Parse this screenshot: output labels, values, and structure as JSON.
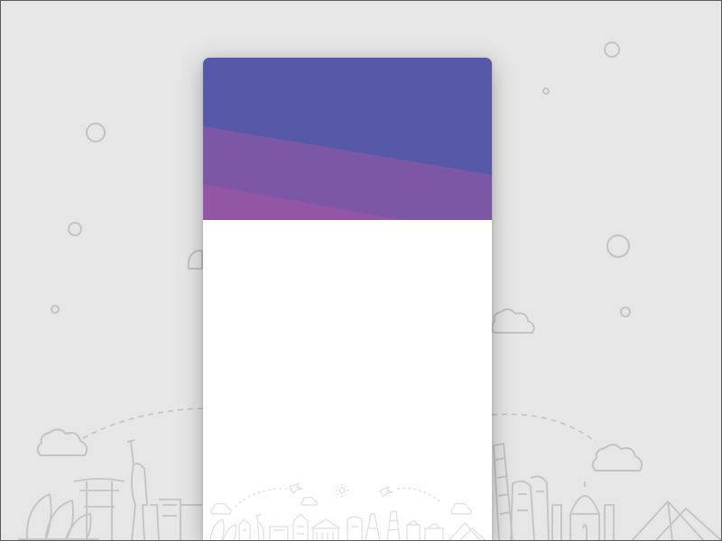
{
  "colors": {
    "background": "#e6e6e6",
    "line_art": "#c3c3c3",
    "card": "#ffffff",
    "header_top": "#5658a8",
    "header_mid": "#7c57a6",
    "header_bottom": "#9356a5"
  },
  "icons": {
    "backdrop": [
      "bubble-icon",
      "cloud-icon",
      "flight-path-icon",
      "sydney-opera-house-icon",
      "torii-gate-icon",
      "statue-of-liberty-icon",
      "leaning-tower-icon",
      "moai-icon",
      "taj-mahal-icon",
      "pyramid-icon"
    ],
    "card_footer": [
      "world-landmarks-skyline-icon",
      "airplane-icon",
      "sun-icon"
    ]
  }
}
